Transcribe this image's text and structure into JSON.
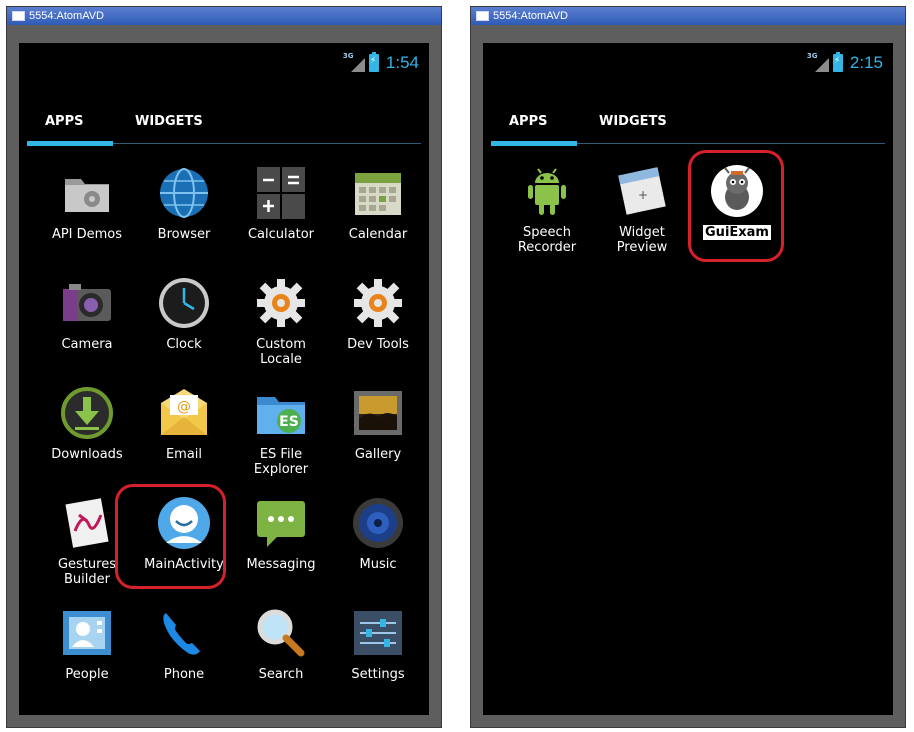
{
  "windows": [
    {
      "title": "5554:AtomAVD",
      "time": "1:54",
      "signal": "3G",
      "tabs": [
        {
          "label": "APPS"
        },
        {
          "label": "WIDGETS"
        }
      ],
      "apps": [
        {
          "label": "API Demos",
          "icon": "folder-gear-icon"
        },
        {
          "label": "Browser",
          "icon": "globe-icon"
        },
        {
          "label": "Calculator",
          "icon": "calculator-icon"
        },
        {
          "label": "Calendar",
          "icon": "calendar-icon"
        },
        {
          "label": "Camera",
          "icon": "camera-icon"
        },
        {
          "label": "Clock",
          "icon": "clock-icon"
        },
        {
          "label": "Custom\nLocale",
          "icon": "gear-icon"
        },
        {
          "label": "Dev Tools",
          "icon": "gear-icon"
        },
        {
          "label": "Downloads",
          "icon": "download-icon"
        },
        {
          "label": "Email",
          "icon": "envelope-icon"
        },
        {
          "label": "ES File\nExplorer",
          "icon": "folder-icon"
        },
        {
          "label": "Gallery",
          "icon": "gallery-icon"
        },
        {
          "label": "Gestures\nBuilder",
          "icon": "gestures-icon"
        },
        {
          "label": "MainActivity",
          "icon": "person-icon"
        },
        {
          "label": "Messaging",
          "icon": "message-icon"
        },
        {
          "label": "Music",
          "icon": "speaker-icon"
        },
        {
          "label": "People",
          "icon": "contact-card-icon"
        },
        {
          "label": "Phone",
          "icon": "phone-icon"
        },
        {
          "label": "Search",
          "icon": "magnifier-icon"
        },
        {
          "label": "Settings",
          "icon": "sliders-icon"
        }
      ]
    },
    {
      "title": "5554:AtomAVD",
      "time": "2:15",
      "signal": "3G",
      "tabs": [
        {
          "label": "APPS"
        },
        {
          "label": "WIDGETS"
        }
      ],
      "apps": [
        {
          "label": "Speech\nRecorder",
          "icon": "android-icon"
        },
        {
          "label": "Widget\nPreview",
          "icon": "widget-preview-icon"
        },
        {
          "label": "GuiExam",
          "icon": "bug-mascot-icon"
        }
      ]
    }
  ],
  "colors": {
    "accent": "#33b5e5",
    "highlight": "#d6212b",
    "screen": "#000000",
    "frame": "#5e5e5e",
    "titlebar": "#2f5bb6"
  }
}
